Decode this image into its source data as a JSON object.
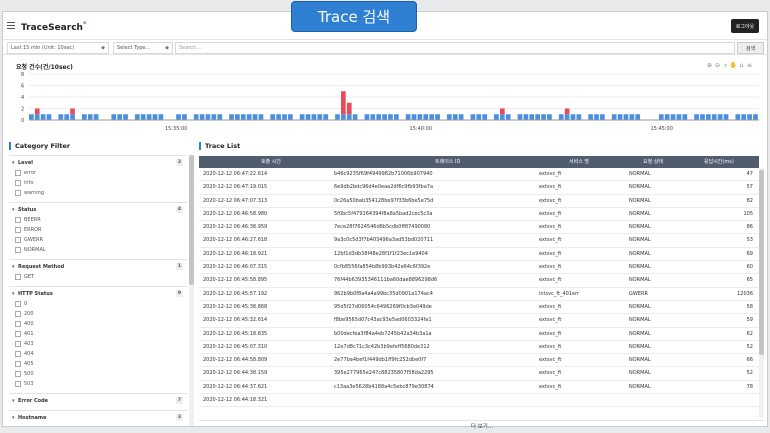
{
  "callout": "Trace 검색",
  "app": {
    "title": "TraceSearch",
    "title_mark": "*",
    "logout_label": "로그아웃"
  },
  "filters": {
    "time_range": "Last 15 min (Unit: 10sec)",
    "type_select": "Select Type...",
    "search_placeholder": "Search...",
    "search_button": "검색"
  },
  "chart_tools": [
    "zoom-in-icon",
    "zoom-out-icon",
    "magnify-icon",
    "pan-icon",
    "home-icon",
    "menu-icon"
  ],
  "chart_data": {
    "type": "bar",
    "title": "요청 건수(건/10sec)",
    "y_ticks": [
      "8",
      "6",
      "4",
      "2",
      "0"
    ],
    "ylim": [
      0,
      8
    ],
    "x_ticks": [
      "15:35:00",
      "15:40:00",
      "15:45:00"
    ],
    "colors": {
      "normal": "#4a90e2",
      "error": "#e84c5a"
    },
    "series": [
      {
        "values": [
          1,
          1,
          1,
          1,
          0,
          1,
          1,
          1,
          0,
          1,
          1,
          1,
          0,
          0,
          1,
          1,
          1,
          0,
          1,
          1,
          1,
          1,
          1,
          0,
          0,
          1,
          1,
          0,
          1,
          1,
          1,
          1,
          1,
          0,
          1,
          1,
          1,
          1,
          1,
          1,
          0,
          1,
          1,
          1,
          1,
          0,
          1,
          1,
          1,
          1,
          1,
          0,
          1,
          1,
          1,
          1,
          0,
          1,
          1,
          1,
          1,
          1,
          1,
          0,
          1,
          1,
          1,
          1,
          1,
          1,
          0,
          1,
          1,
          1,
          0,
          1,
          1,
          1,
          0,
          1,
          1,
          1,
          0,
          1,
          1,
          1,
          1,
          1,
          1,
          0,
          1,
          1,
          1,
          1,
          0,
          1,
          1,
          1,
          0,
          1,
          1,
          1,
          1,
          1,
          0,
          0,
          0,
          1,
          1,
          1,
          1,
          1,
          0,
          1,
          1,
          1,
          1,
          1,
          1,
          0,
          1,
          1,
          1,
          1
        ]
      },
      {
        "values": [
          0,
          1,
          0,
          0,
          0,
          0,
          0,
          1,
          0,
          0,
          0,
          0,
          0,
          0,
          0,
          0,
          0,
          0,
          0,
          0,
          0,
          0,
          0,
          0,
          0,
          0,
          0,
          0,
          0,
          0,
          0,
          0,
          0,
          0,
          0,
          0,
          0,
          0,
          0,
          0,
          0,
          0,
          0,
          0,
          0,
          0,
          0,
          0,
          0,
          0,
          0,
          0,
          0,
          4,
          2,
          0,
          0,
          0,
          0,
          0,
          0,
          0,
          0,
          0,
          0,
          0,
          0,
          0,
          0,
          0,
          0,
          0,
          0,
          0,
          0,
          0,
          0,
          0,
          0,
          0,
          1,
          0,
          0,
          0,
          0,
          0,
          0,
          0,
          0,
          0,
          0,
          1,
          0,
          0,
          0,
          0,
          0,
          0,
          0,
          0,
          0,
          0,
          0,
          0,
          0,
          0,
          0,
          0,
          0,
          0,
          0,
          0,
          0,
          0,
          0,
          0,
          0,
          0,
          0,
          0,
          0,
          0,
          0,
          0
        ]
      }
    ]
  },
  "category": {
    "title": "Category Filter",
    "sections": [
      {
        "name": "Level",
        "count": "3",
        "items": [
          "error",
          "info",
          "warning"
        ]
      },
      {
        "name": "Status",
        "count": "4",
        "items": [
          "BEERR",
          "ERROR",
          "GWERR",
          "NORMAL"
        ]
      },
      {
        "name": "Request Method",
        "count": "1",
        "items": [
          "GET"
        ]
      },
      {
        "name": "HTTP Status",
        "count": "9",
        "items": [
          "0",
          "200",
          "400",
          "401",
          "403",
          "404",
          "405",
          "500",
          "503"
        ]
      },
      {
        "name": "Error Code",
        "count": "7",
        "items": []
      },
      {
        "name": "Hostname",
        "count": "3",
        "items": []
      }
    ]
  },
  "trace": {
    "title": "Trace List",
    "columns": [
      "호출 시간",
      "트레이스 ID",
      "서비스 명",
      "요청 상태",
      "응답시간(ms)"
    ],
    "rows": [
      [
        "2020-12-12 06:47:22.614",
        "b46c9235f69f4949982b71006b907940",
        "extsvc_ft",
        "NORMAL",
        "47"
      ],
      [
        "2020-12-12 06:47:19.015",
        "6e9db2bdc96d4e0eaa2df6c9fb93fba7a",
        "extsvc_ft",
        "NORMAL",
        "57"
      ],
      [
        "2020-12-12 06:47:07.313",
        "0c26a50bab354128be97f33b6be5e75d",
        "extsvc_ft",
        "NORMAL",
        "82"
      ],
      [
        "2020-12-12 06:46:58.980",
        "5f0bc5f479164394f8a8a5bad2cec5c3a",
        "extsvc_ft",
        "NORMAL",
        "105"
      ],
      [
        "2020-12-12 06:46:38.959",
        "7ece28f7624546d6b5cdb0ff87490080",
        "extsvc_ft",
        "NORMAL",
        "86"
      ],
      [
        "2020-12-12 06:46:27.618",
        "9a3c0c5d3f7b403496a3ad53bd020711",
        "extsvc_ft",
        "NORMAL",
        "53"
      ],
      [
        "2020-12-12 06:46:18.921",
        "12bf1d3db38f48e28f1f1f23ec1e9404",
        "extsvc_ft",
        "NORMAL",
        "69"
      ],
      [
        "2020-12-12 06:46:07.315",
        "0cfb8556fa854b8b993b42e64c6f392e",
        "extsvc_ft",
        "NORMAL",
        "60"
      ],
      [
        "2020-12-12 06:45:58.895",
        "76f44b63935346111ba60dae8896298d6",
        "extsvc_ft",
        "NORMAL",
        "65"
      ],
      [
        "2020-12-12 06:45:57.192",
        "962b9b0f8a4a4a99bc35d0901a174ac4",
        "intsvc_ft_401err",
        "GWERR",
        "12036"
      ],
      [
        "2020-12-12 06:45:38.868",
        "95d5f27d06054c6496269f0cb3e049de",
        "extsvc_ft",
        "NORMAL",
        "58"
      ],
      [
        "2020-12-12 06:45:32.614",
        "f8be9565d07c43ac93e5ad0603324fa1",
        "extsvc_ft",
        "NORMAL",
        "59"
      ],
      [
        "2020-12-12 06:45:18.835",
        "b00decfea3f84a4eb7245b42a34b3a1a",
        "extsvc_ft",
        "NORMAL",
        "62"
      ],
      [
        "2020-12-12 06:45:07.310",
        "12e7d8c71c3c42b3b9efeff5680de312",
        "extsvc_ft",
        "NORMAL",
        "52"
      ],
      [
        "2020-12-12 06:44:58.809",
        "2e77ba4bef1f449db1ff9fc252dbe0f7",
        "extsvc_ft",
        "NORMAL",
        "66"
      ],
      [
        "2020-12-12 06:44:38.159",
        "395e277965e247c88235807f58da2295",
        "extsvc_ft",
        "NORMAL",
        "52"
      ],
      [
        "2020-12-12 06:44:37.621",
        "c13aa3e5628b4188a4c5ebc879e30874",
        "extsvc_ft",
        "NORMAL",
        "78"
      ],
      [
        "2020-12-12 06:44:18.321",
        "",
        "",
        "",
        ""
      ]
    ],
    "more_label": "더 보기..."
  }
}
